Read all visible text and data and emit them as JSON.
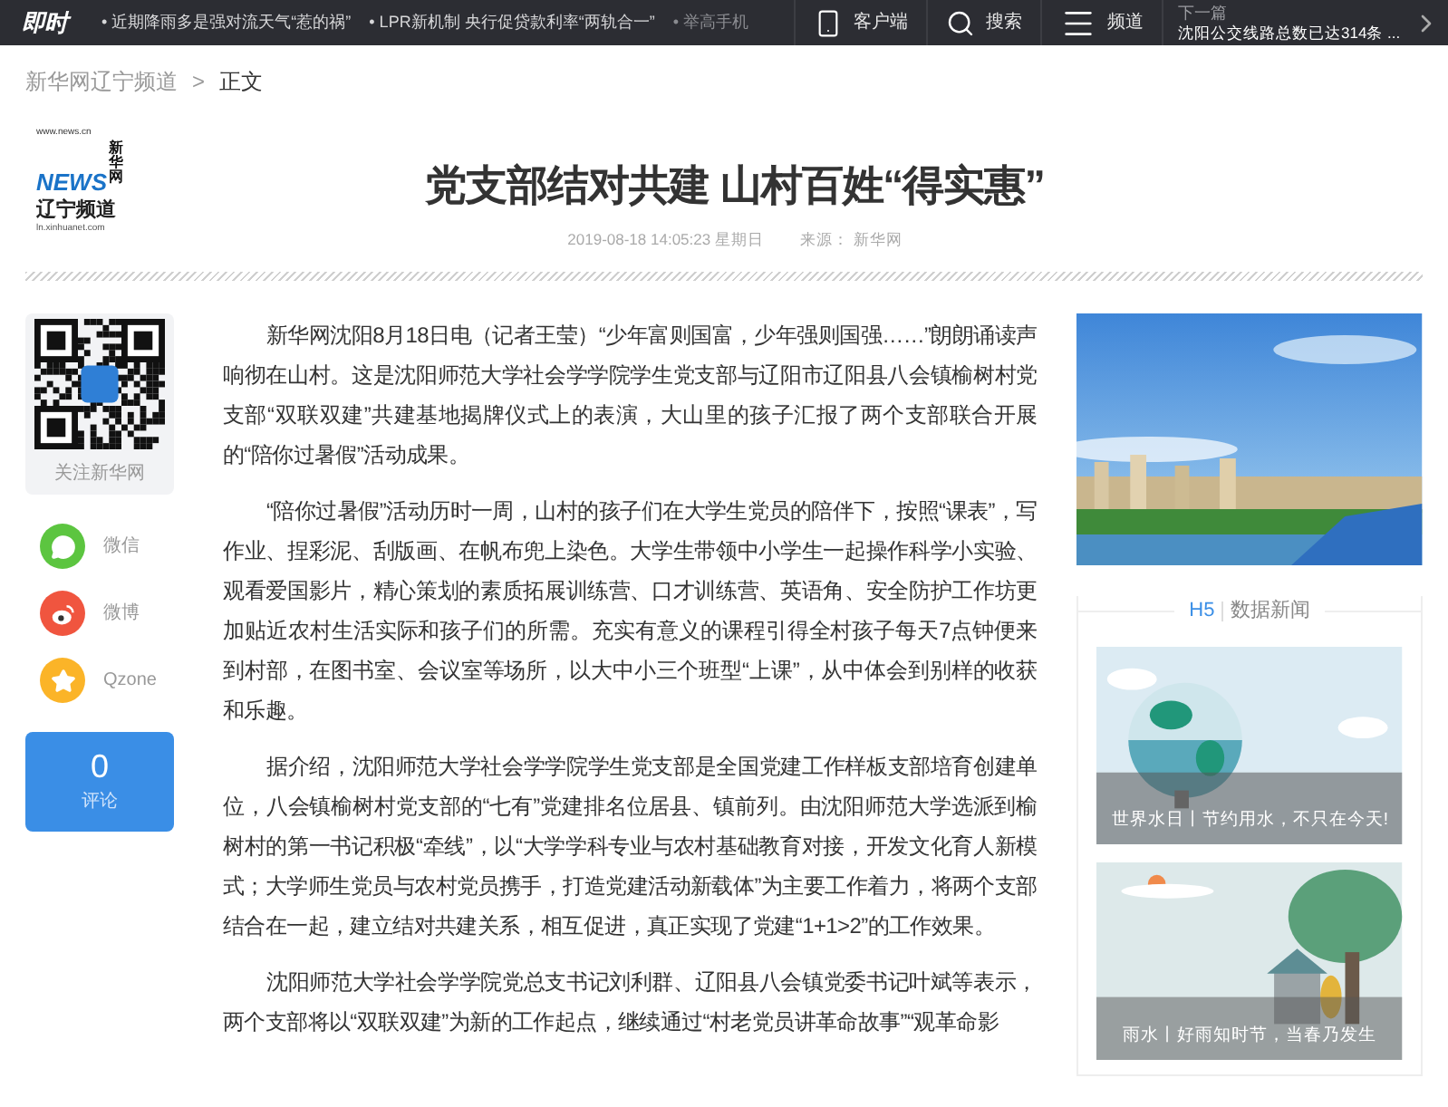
{
  "top_bar": {
    "logo": "即时",
    "headlines": [
      "• 近期降雨多是强对流天气“惹的祸”",
      "• LPR新机制 央行促贷款利率“两轨合一”",
      "• 举高手机"
    ],
    "actions": [
      {
        "kind": "phone",
        "label": "客户端"
      },
      {
        "kind": "search",
        "label": "搜索"
      },
      {
        "kind": "menu",
        "label": "频道"
      }
    ],
    "next": {
      "label": "下一篇",
      "title": "沈阳公交线路总数已达314条 ..."
    }
  },
  "breadcrumb": {
    "items": [
      "新华网辽宁频道",
      "正文"
    ],
    "separator": ">"
  },
  "channel_logo": {
    "url": "www.news.cn",
    "name": "新华网",
    "mark": "NEWS",
    "channel": "辽宁频道",
    "domain": "ln.xinhuanet.com"
  },
  "article": {
    "title": "党支部结对共建 山村百姓“得实惠”",
    "date": "2019-08-18 14:05:23 星期日",
    "source": "来源： 新华网",
    "paragraphs": [
      "新华网沈阳8月18日电（记者王莹）“少年富则国富，少年强则国强……”朗朗诵读声响彻在山村。这是沈阳师范大学社会学学院学生党支部与辽阳市辽阳县八会镇榆树村党支部“双联双建”共建基地揭牌仪式上的表演，大山里的孩子汇报了两个支部联合开展的“陪你过暑假”活动成果。",
      "“陪你过暑假”活动历时一周，山村的孩子们在大学生党员的陪伴下，按照“课表”，写作业、捏彩泥、刮版画、在帆布兜上染色。大学生带领中小学生一起操作科学小实验、观看爱国影片，精心策划的素质拓展训练营、口才训练营、英语角、安全防护工作坊更加贴近农村生活实际和孩子们的所需。充实有意义的课程引得全村孩子每天7点钟便来到村部，在图书室、会议室等场所，以大中小三个班型“上课”，从中体会到别样的收获和乐趣。",
      "据介绍，沈阳师范大学社会学学院学生党支部是全国党建工作样板支部培育创建单位，八会镇榆树村党支部的“七有”党建排名位居县、镇前列。由沈阳师范大学选派到榆树村的第一书记积极“牵线”，以“大学学科专业与农村基础教育对接，开发文化育人新模式；大学师生党员与农村党员携手，打造党建活动新载体”为主要工作着力，将两个支部结合在一起，建立结对共建关系，相互促进，真正实现了党建“1+1>2”的工作效果。",
      "沈阳师范大学社会学学院党总支书记刘利群、辽阳县八会镇党委书记叶斌等表示，两个支部将以“双联双建”为新的工作起点，继续通过“村老党员讲革命故事”“观革命影"
    ]
  },
  "sidebar": {
    "qr_caption": "关注新华网",
    "share": [
      {
        "kind": "wechat",
        "label": "微信",
        "color": "#5cc540"
      },
      {
        "kind": "weibo",
        "label": "微博",
        "color": "#f0553f"
      },
      {
        "kind": "qzone",
        "label": "Qzone",
        "color": "#fbb428"
      }
    ],
    "comments": {
      "count": "0",
      "label": "评论"
    }
  },
  "right": {
    "h5_box": {
      "tag": "H5",
      "title": "数据新闻",
      "cards": [
        {
          "kind": "globe",
          "caption": "世界水日丨节约用水，不只在今天!"
        },
        {
          "kind": "tree",
          "caption": "雨水丨好雨知时节，当春乃发生"
        }
      ]
    }
  }
}
